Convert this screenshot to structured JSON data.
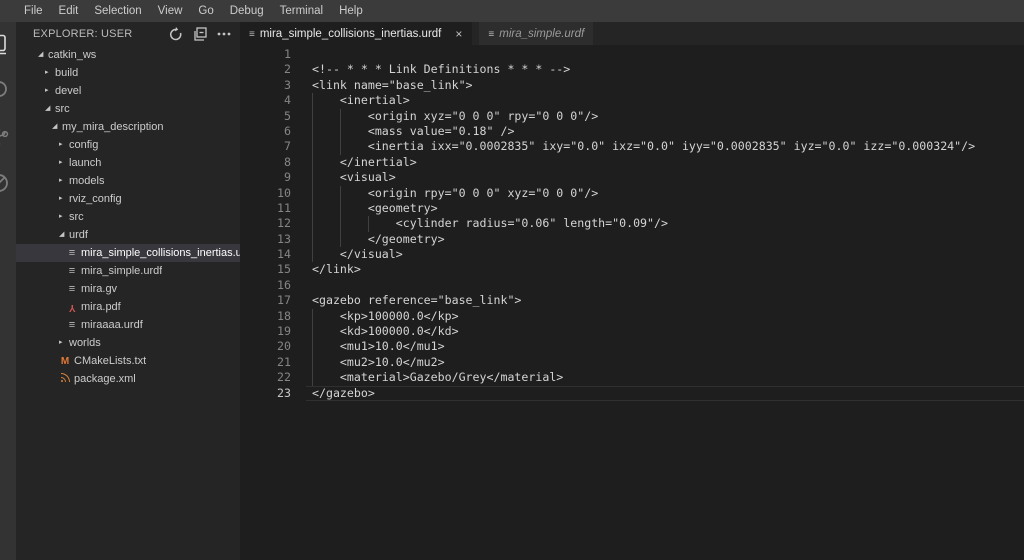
{
  "menu_bar": {
    "items": [
      "File",
      "Edit",
      "Selection",
      "View",
      "Go",
      "Debug",
      "Terminal",
      "Help"
    ]
  },
  "activity_bar": {
    "icons": [
      "files-icon",
      "search-icon",
      "source-control-icon",
      "debug-icon"
    ]
  },
  "explorer": {
    "title": "EXPLORER: USER",
    "actions": [
      {
        "name": "refresh-button",
        "icon": "refresh-icon"
      },
      {
        "name": "collapse-all-button",
        "icon": "collapse-all-icon"
      },
      {
        "name": "more-actions-button",
        "icon": "ellipsis-icon"
      }
    ],
    "tree": [
      {
        "label": "catkin_ws",
        "kind": "folder",
        "depth": 0,
        "expanded": true
      },
      {
        "label": "build",
        "kind": "folder",
        "depth": 1,
        "expanded": false
      },
      {
        "label": "devel",
        "kind": "folder",
        "depth": 1,
        "expanded": false
      },
      {
        "label": "src",
        "kind": "folder",
        "depth": 1,
        "expanded": true
      },
      {
        "label": "my_mira_description",
        "kind": "folder",
        "depth": 2,
        "expanded": true
      },
      {
        "label": "config",
        "kind": "folder",
        "depth": 3,
        "expanded": false
      },
      {
        "label": "launch",
        "kind": "folder",
        "depth": 3,
        "expanded": false
      },
      {
        "label": "models",
        "kind": "folder",
        "depth": 3,
        "expanded": false
      },
      {
        "label": "rviz_config",
        "kind": "folder",
        "depth": 3,
        "expanded": false
      },
      {
        "label": "src",
        "kind": "folder",
        "depth": 3,
        "expanded": false
      },
      {
        "label": "urdf",
        "kind": "folder",
        "depth": 3,
        "expanded": true
      },
      {
        "label": "mira_simple_collisions_inertias.urdf",
        "kind": "file",
        "depth": 4,
        "icon": "file-icon",
        "selected": true
      },
      {
        "label": "mira_simple.urdf",
        "kind": "file",
        "depth": 4,
        "icon": "file-icon"
      },
      {
        "label": "mira.gv",
        "kind": "file",
        "depth": 4,
        "icon": "file-icon"
      },
      {
        "label": "mira.pdf",
        "kind": "file",
        "depth": 4,
        "icon": "pdf-icon"
      },
      {
        "label": "miraaaa.urdf",
        "kind": "file",
        "depth": 4,
        "icon": "file-icon"
      },
      {
        "label": "worlds",
        "kind": "folder",
        "depth": 3,
        "expanded": false
      },
      {
        "label": "CMakeLists.txt",
        "kind": "file",
        "depth": 3,
        "icon": "cmake-icon"
      },
      {
        "label": "package.xml",
        "kind": "file",
        "depth": 3,
        "icon": "xml-icon"
      }
    ]
  },
  "tabs": [
    {
      "label": "mira_simple_collisions_inertias.urdf",
      "icon": "file-icon",
      "active": true,
      "preview": false,
      "close_label": "×"
    },
    {
      "label": "mira_simple.urdf",
      "icon": "file-icon",
      "active": false,
      "preview": true
    }
  ],
  "editor": {
    "active_line": 23,
    "lines": [
      "",
      "<!-- * * * Link Definitions * * * -->",
      "<link name=\"base_link\">",
      "    <inertial>",
      "        <origin xyz=\"0 0 0\" rpy=\"0 0 0\"/>",
      "        <mass value=\"0.18\" />",
      "        <inertia ixx=\"0.0002835\" ixy=\"0.0\" ixz=\"0.0\" iyy=\"0.0002835\" iyz=\"0.0\" izz=\"0.000324\"/>",
      "    </inertial>",
      "    <visual>",
      "        <origin rpy=\"0 0 0\" xyz=\"0 0 0\"/>",
      "        <geometry>",
      "            <cylinder radius=\"0.06\" length=\"0.09\"/>",
      "        </geometry>",
      "    </visual>",
      "</link>",
      "",
      "<gazebo reference=\"base_link\">",
      "    <kp>100000.0</kp>",
      "    <kd>100000.0</kd>",
      "    <mu1>10.0</mu1>",
      "    <mu2>10.0</mu2>",
      "    <material>Gazebo/Grey</material>",
      "</gazebo>"
    ]
  },
  "colors": {
    "menubar_bg": "#3b3b3b",
    "activitybar_bg": "#333333",
    "sidebar_bg": "#252526",
    "selection_bg": "#37373d",
    "editor_bg": "#1e1e1e",
    "code_text": "#d4d4d4",
    "line_number": "#858585",
    "pdf_icon": "#cc5550",
    "cmake_icon": "#e37933",
    "xml_icon": "#d9823b"
  }
}
